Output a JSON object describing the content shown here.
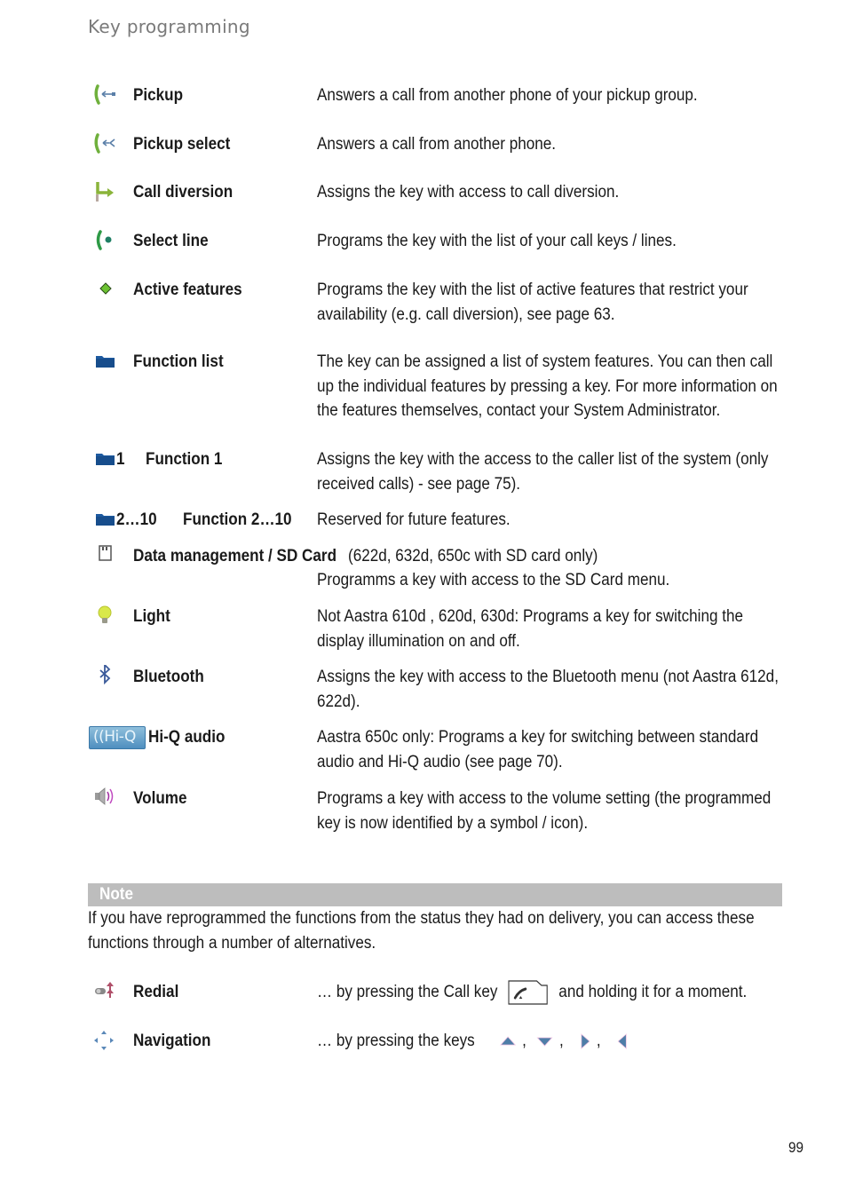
{
  "header": {
    "title": "Key programming"
  },
  "features": [
    {
      "icon": "pickup-icon",
      "label": "Pickup",
      "desc": "Answers a call from another phone of your pickup group."
    },
    {
      "icon": "pickup-select-icon",
      "label": "Pickup select",
      "desc": "Answers a call from another phone."
    },
    {
      "icon": "call-diversion-icon",
      "label": "Call diversion",
      "desc": "Assigns the key with access to call diversion."
    },
    {
      "icon": "select-line-icon",
      "label": "Select line",
      "desc": "Programs the key with the list of your call keys / lines."
    },
    {
      "icon": "active-features-icon",
      "label": "Active features",
      "desc": "Programs the key with the list of active features that restrict your availability (e.g. call diversion), see page 63."
    },
    {
      "icon": "folder-icon",
      "label": "Function list",
      "desc": "The key can be assigned a list of system features. You can then call up the individual features by pressing a key. For more information on the features themselves, contact your System Administrator."
    },
    {
      "icon": "folder-icon",
      "num": "1",
      "label": "Function 1",
      "desc": "Assigns the key with the access to the caller list of the system (only received calls) - see page  75)."
    },
    {
      "icon": "folder-icon",
      "num": "2…10",
      "label": "Function 2…10",
      "desc": "Reserved for future features."
    },
    {
      "icon": "sd-card-icon",
      "label": "Data management / SD Card",
      "note": "(622d, 632d, 650c with SD card only)",
      "desc": "Programms a key with access to the SD Card menu."
    },
    {
      "icon": "light-bulb-icon",
      "label": "Light",
      "desc": "Not Aastra 610d , 620d, 630d: Programs a key for switching the display illumination on and off."
    },
    {
      "icon": "bluetooth-icon",
      "label": "Bluetooth",
      "desc": "Assigns the key with access to the Bluetooth menu (not Aastra 612d, 622d)."
    },
    {
      "icon": "hiq-audio-icon",
      "icon_text": "Hi-Q",
      "label": "Hi-Q audio",
      "desc": "Aastra 650c only: Programs a key for switching between standard audio and Hi-Q audio (see page 70)."
    },
    {
      "icon": "volume-icon",
      "label": "Volume",
      "desc": "Programs a key with access to the volume setting (the programmed key is now identified by a symbol / icon)."
    }
  ],
  "note": {
    "title": "Note",
    "text": "If you have reprogrammed the functions from the status they had on delivery, you can access these functions through a number of alternatives."
  },
  "alternatives": [
    {
      "icon": "redial-icon",
      "label": "Redial",
      "desc_before": "… by pressing the Call key",
      "key_icon": "call-key-icon",
      "desc_after": "and holding it for a moment."
    },
    {
      "icon": "navigation-icon",
      "label": "Navigation",
      "desc_before": "… by pressing the keys",
      "keys": [
        "up-arrow-key",
        "down-arrow-key",
        "right-arrow-key",
        "left-arrow-key"
      ],
      "separator": ","
    }
  ],
  "page_number": "99"
}
